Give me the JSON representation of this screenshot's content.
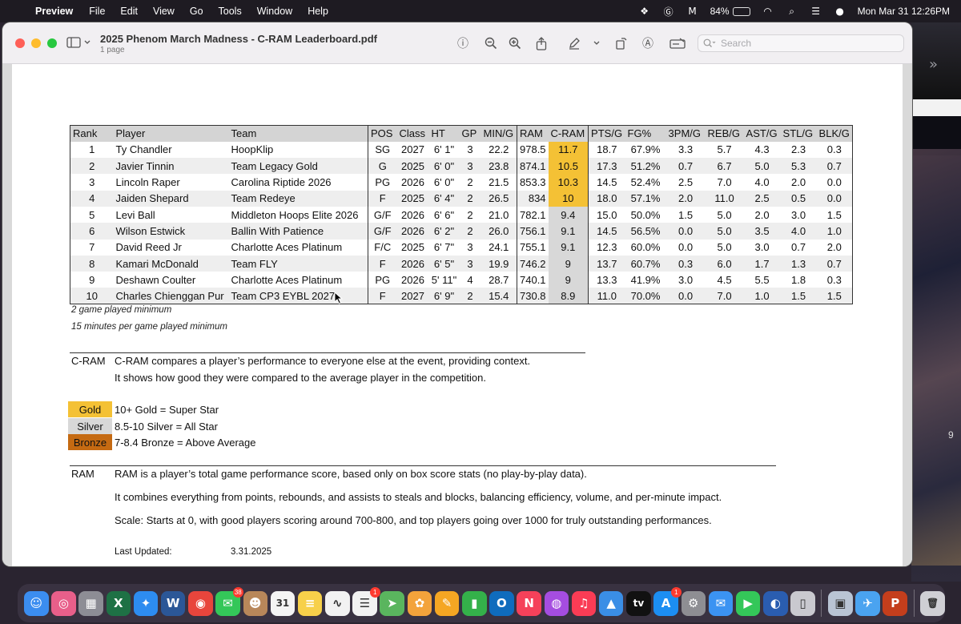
{
  "menubar": {
    "app_name": "Preview",
    "menus": [
      "File",
      "Edit",
      "View",
      "Go",
      "Tools",
      "Window",
      "Help"
    ],
    "battery": "84%",
    "datetime": "Mon Mar 31  12:26PM"
  },
  "window": {
    "title": "2025 Phenom March Madness - C-RAM Leaderboard.pdf",
    "subtitle": "1 page",
    "search_placeholder": "Search"
  },
  "leaderboard": {
    "headers": [
      "Rank",
      "Player",
      "Team",
      "POS",
      "Class",
      "HT",
      "GP",
      "MIN/G",
      "RAM",
      "C-RAM",
      "PTS/G",
      "FG%",
      "3PM/G",
      "REB/G",
      "AST/G",
      "STL/G",
      "BLK/G"
    ],
    "rows": [
      {
        "rank": "1",
        "player": "Ty Chandler",
        "team": "HoopKlip",
        "pos": "SG",
        "class": "2027",
        "ht": "6' 1\"",
        "gp": "3",
        "min": "22.2",
        "ram": "978.5",
        "cram": "11.7",
        "tier": "gold",
        "pts": "18.7",
        "fg": "67.9%",
        "tpm": "3.3",
        "reb": "5.7",
        "ast": "4.3",
        "stl": "2.3",
        "blk": "0.3"
      },
      {
        "rank": "2",
        "player": "Javier Tinnin",
        "team": "Team Legacy Gold",
        "pos": "G",
        "class": "2025",
        "ht": "6' 0\"",
        "gp": "3",
        "min": "23.8",
        "ram": "874.1",
        "cram": "10.5",
        "tier": "gold",
        "pts": "17.3",
        "fg": "51.2%",
        "tpm": "0.7",
        "reb": "6.7",
        "ast": "5.0",
        "stl": "5.3",
        "blk": "0.7"
      },
      {
        "rank": "3",
        "player": "Lincoln Raper",
        "team": "Carolina Riptide 2026",
        "pos": "PG",
        "class": "2026",
        "ht": "6' 0\"",
        "gp": "2",
        "min": "21.5",
        "ram": "853.3",
        "cram": "10.3",
        "tier": "gold",
        "pts": "14.5",
        "fg": "52.4%",
        "tpm": "2.5",
        "reb": "7.0",
        "ast": "4.0",
        "stl": "2.0",
        "blk": "0.0"
      },
      {
        "rank": "4",
        "player": "Jaiden Shepard",
        "team": "Team Redeye",
        "pos": "F",
        "class": "2025",
        "ht": "6' 4\"",
        "gp": "2",
        "min": "26.5",
        "ram": "834",
        "cram": "10",
        "tier": "gold",
        "pts": "18.0",
        "fg": "57.1%",
        "tpm": "2.0",
        "reb": "11.0",
        "ast": "2.5",
        "stl": "0.5",
        "blk": "0.0"
      },
      {
        "rank": "5",
        "player": "Levi Ball",
        "team": "Middleton Hoops Elite 2026",
        "pos": "G/F",
        "class": "2026",
        "ht": "6' 6\"",
        "gp": "2",
        "min": "21.0",
        "ram": "782.1",
        "cram": "9.4",
        "tier": "silver",
        "pts": "15.0",
        "fg": "50.0%",
        "tpm": "1.5",
        "reb": "5.0",
        "ast": "2.0",
        "stl": "3.0",
        "blk": "1.5"
      },
      {
        "rank": "6",
        "player": "Wilson Estwick",
        "team": "Ballin With Patience",
        "pos": "G/F",
        "class": "2026",
        "ht": "6' 2\"",
        "gp": "2",
        "min": "26.0",
        "ram": "756.1",
        "cram": "9.1",
        "tier": "silver",
        "pts": "14.5",
        "fg": "56.5%",
        "tpm": "0.0",
        "reb": "5.0",
        "ast": "3.5",
        "stl": "4.0",
        "blk": "1.0"
      },
      {
        "rank": "7",
        "player": "David Reed Jr",
        "team": "Charlotte Aces Platinum",
        "pos": "F/C",
        "class": "2025",
        "ht": "6' 7\"",
        "gp": "3",
        "min": "24.1",
        "ram": "755.1",
        "cram": "9.1",
        "tier": "silver",
        "pts": "12.3",
        "fg": "60.0%",
        "tpm": "0.0",
        "reb": "5.0",
        "ast": "3.0",
        "stl": "0.7",
        "blk": "2.0"
      },
      {
        "rank": "8",
        "player": "Kamari McDonald",
        "team": "Team FLY",
        "pos": "F",
        "class": "2026",
        "ht": "6' 5\"",
        "gp": "3",
        "min": "19.9",
        "ram": "746.2",
        "cram": "9",
        "tier": "silver",
        "pts": "13.7",
        "fg": "60.7%",
        "tpm": "0.3",
        "reb": "6.0",
        "ast": "1.7",
        "stl": "1.3",
        "blk": "0.7"
      },
      {
        "rank": "9",
        "player": "Deshawn Coulter",
        "team": "Charlotte Aces Platinum",
        "pos": "PG",
        "class": "2026",
        "ht": "5' 11\"",
        "gp": "4",
        "min": "28.7",
        "ram": "740.1",
        "cram": "9",
        "tier": "silver",
        "pts": "13.3",
        "fg": "41.9%",
        "tpm": "3.0",
        "reb": "4.5",
        "ast": "5.5",
        "stl": "1.8",
        "blk": "0.3"
      },
      {
        "rank": "10",
        "player": "Charles Chienggan Pur",
        "team": "Team CP3 EYBL 2027",
        "pos": "F",
        "class": "2027",
        "ht": "6' 9\"",
        "gp": "2",
        "min": "15.4",
        "ram": "730.8",
        "cram": "8.9",
        "tier": "silver",
        "pts": "11.0",
        "fg": "70.0%",
        "tpm": "0.0",
        "reb": "7.0",
        "ast": "1.0",
        "stl": "1.5",
        "blk": "1.5"
      }
    ]
  },
  "notes": {
    "min_games": "2 game played minimum",
    "min_minutes": "15 minutes per game played minimum"
  },
  "cram_section": {
    "key": "C-RAM",
    "line1": "C-RAM compares a player’s performance to everyone else at the event, providing context.",
    "line2": "It shows how good they were compared to the average player in the competition."
  },
  "tiers": [
    {
      "label": "Gold",
      "desc": "10+ Gold = Super Star",
      "color": "#f4c135"
    },
    {
      "label": "Silver",
      "desc": "8.5-10 Silver = All Star",
      "color": "#d8d8d8"
    },
    {
      "label": "Bronze",
      "desc": "7-8.4 Bronze = Above Average",
      "color": "#c56a12"
    }
  ],
  "ram_section": {
    "key": "RAM",
    "line1": "RAM is a player’s total game performance score, based only on box score stats (no play-by-play data).",
    "line2": "It combines everything from points, rebounds, and assists to steals and blocks, balancing efficiency, volume, and per-minute impact.",
    "line3": "Scale: Starts at 0, with good players scoring around 700-800, and top players going over 1000 for truly outstanding performances."
  },
  "updated": {
    "label": "Last Updated:",
    "date": "3.31.2025"
  },
  "desktop": {
    "edge_digit": "9"
  },
  "dock": {
    "apps": [
      {
        "name": "finder-icon",
        "glyph": "☺",
        "color": "#3b8df0"
      },
      {
        "name": "browser-icon",
        "glyph": "◎",
        "color": "#e85f8a"
      },
      {
        "name": "launchpad-icon",
        "glyph": "▦",
        "color": "#8d8d95"
      },
      {
        "name": "excel-icon",
        "glyph": "X",
        "color": "#1e7145"
      },
      {
        "name": "safari-icon",
        "glyph": "✦",
        "color": "#2d8cf0"
      },
      {
        "name": "word-icon",
        "glyph": "W",
        "color": "#2b5797"
      },
      {
        "name": "chrome-icon",
        "glyph": "◉",
        "color": "#e8453c"
      },
      {
        "name": "messages-icon",
        "glyph": "✉",
        "color": "#34c759",
        "badge": "38"
      },
      {
        "name": "contacts-icon",
        "glyph": "☻",
        "color": "#b8875a"
      },
      {
        "name": "calendar-icon",
        "glyph": "31",
        "color": "#f4f4f4"
      },
      {
        "name": "notes-icon",
        "glyph": "≡",
        "color": "#f7d04a"
      },
      {
        "name": "freeform-icon",
        "glyph": "∿",
        "color": "#f2f2f2"
      },
      {
        "name": "reminders-icon",
        "glyph": "☰",
        "color": "#f2f2f2",
        "badge": "1"
      },
      {
        "name": "maps-icon",
        "glyph": "➤",
        "color": "#5ab55e"
      },
      {
        "name": "photos-icon",
        "glyph": "✿",
        "color": "#f3a33b"
      },
      {
        "name": "pages-icon",
        "glyph": "✎",
        "color": "#f5a623"
      },
      {
        "name": "numbers-icon",
        "glyph": "▮",
        "color": "#34b14a"
      },
      {
        "name": "outlook-icon",
        "glyph": "O",
        "color": "#0f6cbd"
      },
      {
        "name": "news-icon",
        "glyph": "N",
        "color": "#f5415a"
      },
      {
        "name": "podcasts-icon",
        "glyph": "◍",
        "color": "#a54de0"
      },
      {
        "name": "music-icon",
        "glyph": "♫",
        "color": "#fa3c55"
      },
      {
        "name": "keynote-icon",
        "glyph": "▲",
        "color": "#3a8ee6"
      },
      {
        "name": "tv-icon",
        "glyph": "tv",
        "color": "#111111"
      },
      {
        "name": "app-store-icon",
        "glyph": "A",
        "color": "#1c8ef2",
        "badge": "1"
      },
      {
        "name": "settings-icon",
        "glyph": "⚙",
        "color": "#8e8e93"
      },
      {
        "name": "mail-icon",
        "glyph": "✉",
        "color": "#3b93f2"
      },
      {
        "name": "facetime-icon",
        "glyph": "▶",
        "color": "#34c759"
      },
      {
        "name": "screen-sharing-icon",
        "glyph": "◐",
        "color": "#2a5db0"
      },
      {
        "name": "iphone-mirroring-icon",
        "glyph": "▯",
        "color": "#c9c9cf"
      },
      {
        "name": "preview-icon",
        "glyph": "▣",
        "color": "#b9c4d4"
      },
      {
        "name": "testflight-icon",
        "glyph": "✈",
        "color": "#4aa3f0"
      },
      {
        "name": "powerpoint-icon",
        "glyph": "P",
        "color": "#c43e1c"
      },
      {
        "name": "trash-icon",
        "glyph": "🗑",
        "color": "#cfcfd4"
      }
    ]
  }
}
